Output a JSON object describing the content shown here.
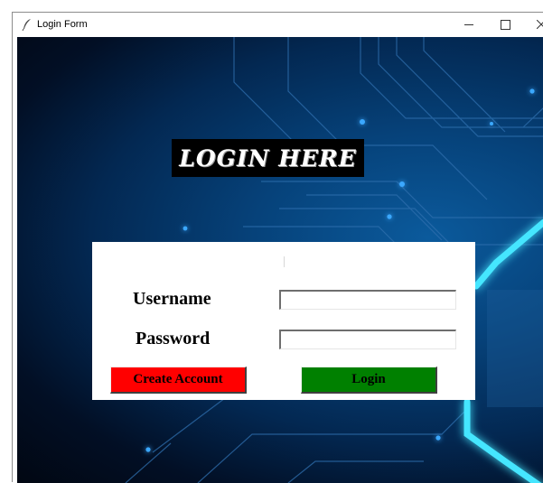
{
  "window": {
    "title": "Login Form",
    "controls": {
      "minimize": "–",
      "maximize": "☐",
      "close": "✕"
    }
  },
  "header": {
    "title": "LOGIN HERE"
  },
  "form": {
    "username_label": "Username",
    "username_value": "",
    "password_label": "Password",
    "password_value": "",
    "create_account_label": "Create Account",
    "login_label": "Login"
  },
  "colors": {
    "create_button": "#ff0000",
    "login_button": "#008000",
    "title_bg": "#000000",
    "background": "#032852"
  },
  "icons": [
    "feather-icon",
    "minimize-icon",
    "maximize-icon",
    "close-icon"
  ]
}
